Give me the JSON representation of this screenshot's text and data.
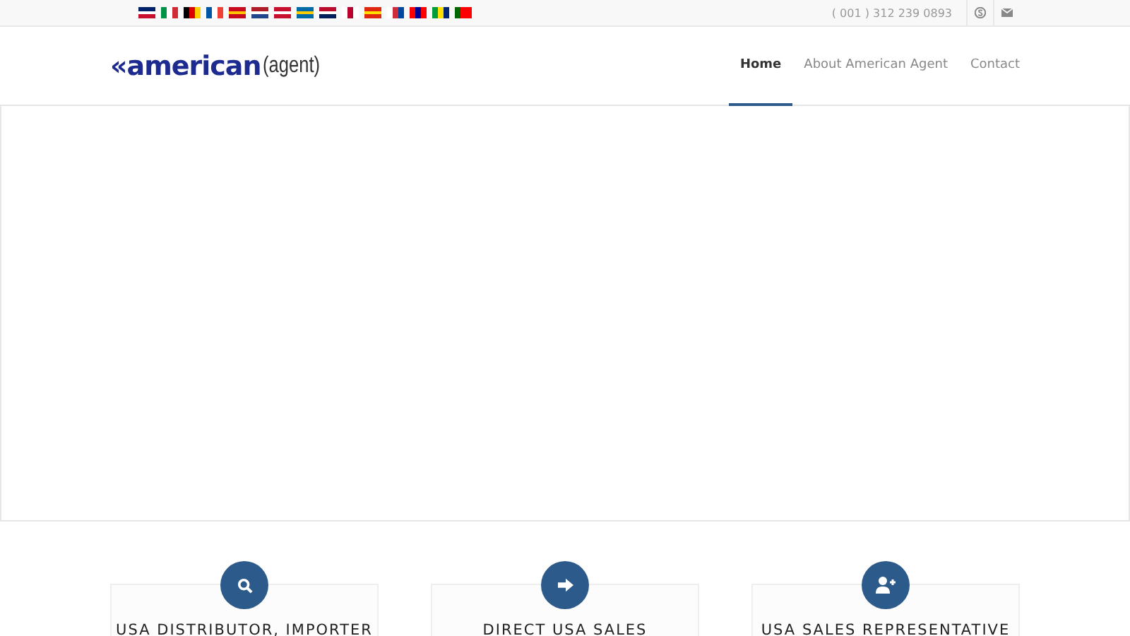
{
  "top_bar": {
    "phone": "( 001 ) 312 239 0893"
  },
  "logo": {
    "mark": "«american",
    "suffix": "(agent)"
  },
  "nav": [
    {
      "label": "Home",
      "selected": true
    },
    {
      "label": "About American Agent",
      "selected": false
    },
    {
      "label": "Contact",
      "selected": false
    }
  ],
  "features": [
    {
      "kind": "search",
      "title": "USA DISTRIBUTOR, IMPORTER"
    },
    {
      "kind": "arrow",
      "title": "DIRECT USA SALES"
    },
    {
      "kind": "user-add",
      "title": "USA SALES REPRESENTATIVE"
    }
  ]
}
